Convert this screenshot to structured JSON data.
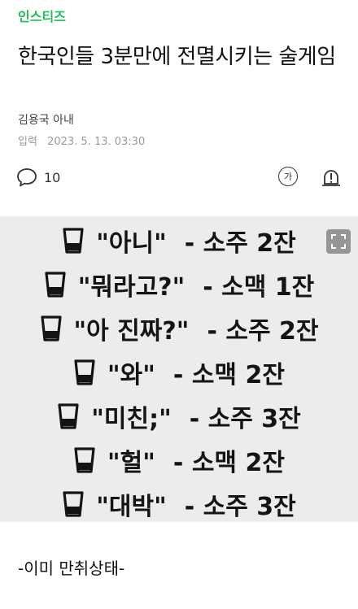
{
  "article": {
    "category": "인스티즈",
    "title": "한국인들 3분만에 전멸시키는 술게임",
    "author": "김용국 아내",
    "date_label": "입력",
    "date": "2023. 5. 13. 03:30"
  },
  "actions": {
    "comment_count": "10",
    "font_size_label": "가"
  },
  "rules": [
    {
      "word": "\"아니\"",
      "drink": "- 소주 2잔"
    },
    {
      "word": "\"뭐라고?\"",
      "drink": "- 소맥 1잔"
    },
    {
      "word": "\"아 진짜?\"",
      "drink": "- 소주 2잔"
    },
    {
      "word": "\"와\"",
      "drink": "- 소맥 2잔"
    },
    {
      "word": "\"미친;\"",
      "drink": "- 소주 3잔"
    },
    {
      "word": "\"헐\"",
      "drink": "- 소맥 2잔"
    },
    {
      "word": "\"대박\"",
      "drink": "- 소주 3잔"
    }
  ],
  "caption": "-이미 만취상태-",
  "colors": {
    "brand": "#1fbf5a",
    "image_background": "#ececec"
  },
  "icons": {
    "comment": "comment-icon",
    "font_size": "font-size-icon",
    "report": "report-icon",
    "expand": "expand-icon",
    "cup": "cup-icon"
  }
}
